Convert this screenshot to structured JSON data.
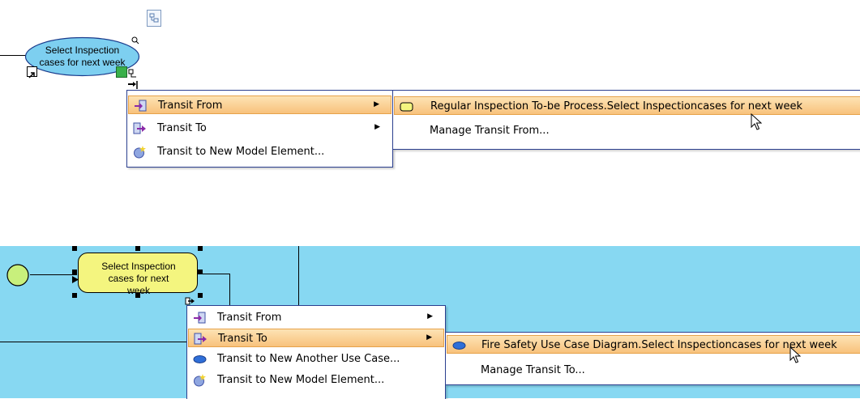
{
  "colors": {
    "canvas_blue": "#87d8f2",
    "ellipse_fill": "#7dcff0",
    "rounded_node_fill": "#f4f57f",
    "start_circle_fill": "#c8f07c",
    "menu_highlight": "#f8c27c",
    "menu_border": "#2b3f8f"
  },
  "top_example": {
    "node_label": "Select Inspection cases for next week",
    "menu": {
      "items": [
        {
          "label": "Transit From",
          "icon": "transit-from-icon",
          "has_submenu": true,
          "highlighted": true
        },
        {
          "label": "Transit To",
          "icon": "transit-to-icon",
          "has_submenu": true,
          "highlighted": false
        },
        {
          "label": "Transit to New Model Element...",
          "icon": "new-model-element-icon",
          "has_submenu": false,
          "highlighted": false
        }
      ]
    },
    "submenu": {
      "items": [
        {
          "label": "Regular Inspection To-be Process.Select Inspectioncases for next week",
          "icon": "rounded-rect-icon",
          "highlighted": true
        },
        {
          "label": "Manage Transit From...",
          "icon": "",
          "highlighted": false
        }
      ]
    }
  },
  "bottom_example": {
    "node_label": "Select Inspection cases for next week",
    "menu": {
      "items": [
        {
          "label": "Transit From",
          "icon": "transit-from-icon",
          "has_submenu": true,
          "highlighted": false
        },
        {
          "label": "Transit To",
          "icon": "transit-to-icon",
          "has_submenu": true,
          "highlighted": true
        },
        {
          "label": "Transit to New Another Use Case...",
          "icon": "use-case-icon",
          "has_submenu": false,
          "highlighted": false
        },
        {
          "label": "Transit to New Model Element...",
          "icon": "new-model-element-icon",
          "has_submenu": false,
          "highlighted": false
        }
      ]
    },
    "submenu": {
      "items": [
        {
          "label": "Fire Safety Use Case Diagram.Select Inspectioncases for next week",
          "icon": "use-case-icon",
          "highlighted": true
        },
        {
          "label": "Manage Transit To...",
          "icon": "",
          "highlighted": false
        }
      ]
    }
  }
}
